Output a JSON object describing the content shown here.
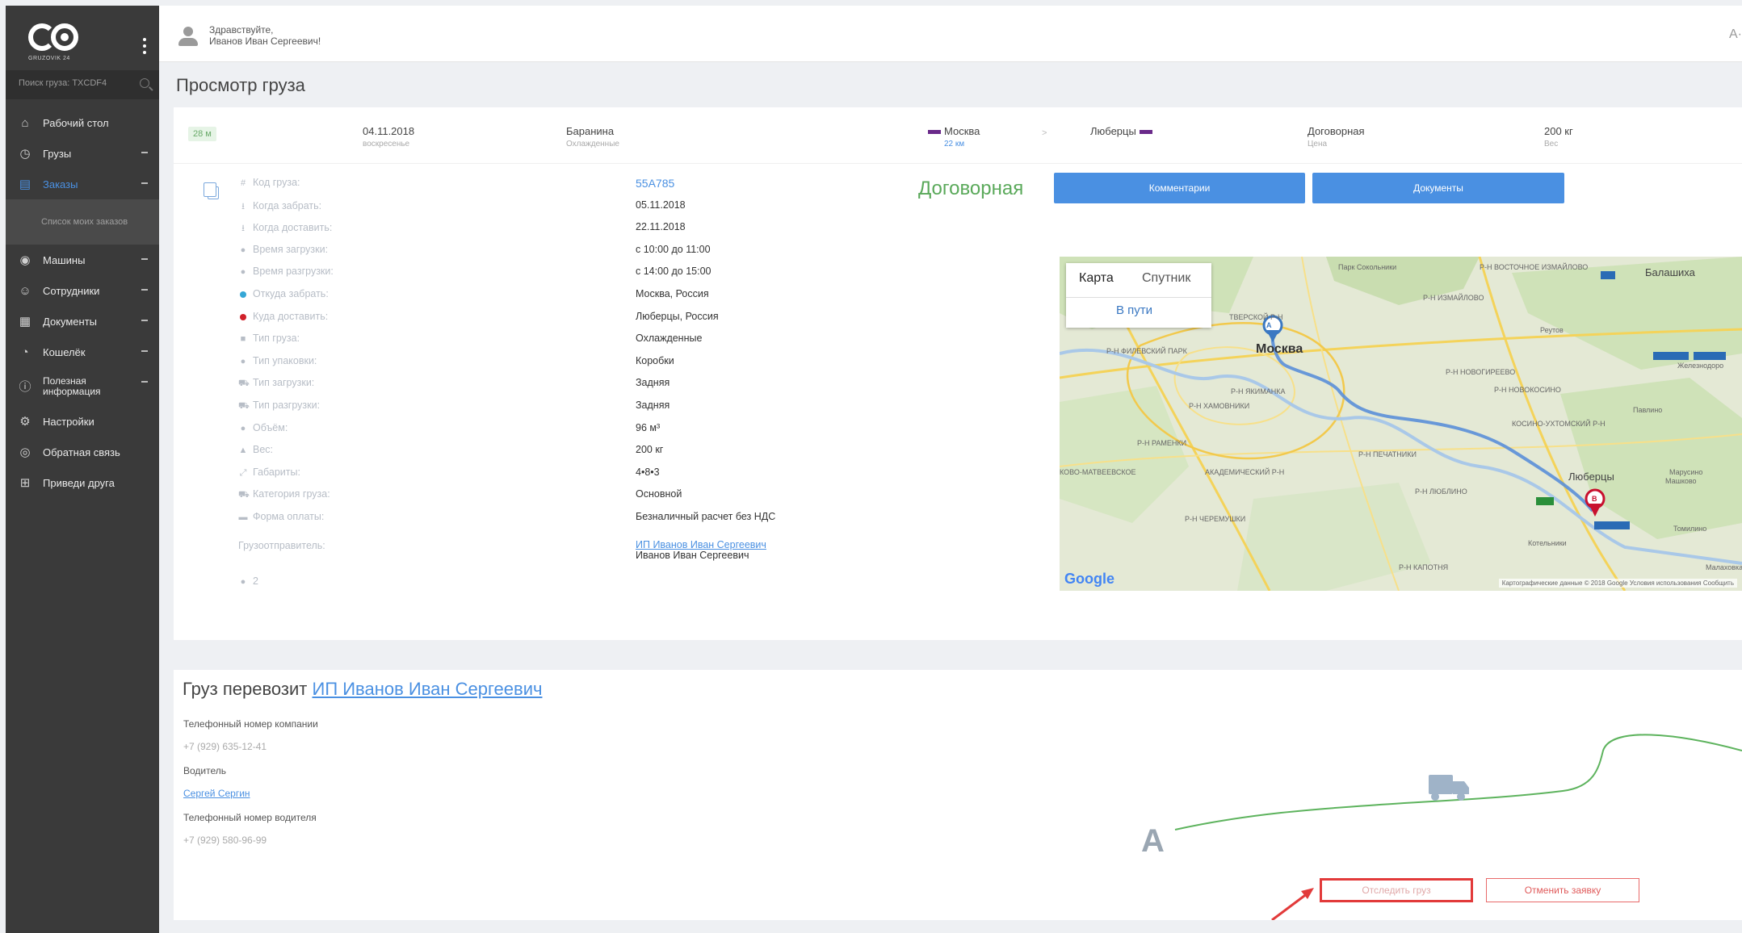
{
  "sidebar": {
    "logo_sub": "GRUZOVIK 24",
    "search_placeholder": "Поиск груза: TXCDF4",
    "items": [
      {
        "label": "Рабочий стол",
        "icon": "desktop-icon"
      },
      {
        "label": "Грузы",
        "icon": "cargo-icon"
      },
      {
        "label": "Заказы",
        "icon": "orders-icon"
      },
      {
        "label": "Список моих заказов",
        "icon": ""
      },
      {
        "label": "Машины",
        "icon": "truck-icon"
      },
      {
        "label": "Сотрудники",
        "icon": "staff-icon"
      },
      {
        "label": "Документы",
        "icon": "documents-icon"
      },
      {
        "label": "Кошелёк",
        "icon": "wallet-icon"
      },
      {
        "label": "Полезная информация",
        "icon": "info-icon"
      },
      {
        "label": "Настройки",
        "icon": "gear-icon"
      },
      {
        "label": "Обратная связь",
        "icon": "feedback-icon"
      },
      {
        "label": "Приведи друга",
        "icon": "gift-icon"
      }
    ]
  },
  "topbar": {
    "greet_line1": "Здравствуйте,",
    "greet_line2": "Иванов Иван Сергеевич!",
    "right_text": "А·"
  },
  "page": {
    "title": "Просмотр груза"
  },
  "summary": {
    "badge": "28 м",
    "date": "04.11.2018",
    "weekday": "воскресенье",
    "cargo": "Баранина",
    "cargo_type": "Охлажденные",
    "from": "Москва",
    "distance": "22 км",
    "chevron": ">",
    "to": "Люберцы",
    "price": "Договорная",
    "price_label": "Цена",
    "weight": "200 кг",
    "weight_label": "Вес"
  },
  "details": [
    {
      "label": "Код груза:",
      "value": "55A785",
      "icon": "#",
      "value_style": "blue"
    },
    {
      "label": "Когда забрать:",
      "value": "05.11.2018",
      "icon": "⭳"
    },
    {
      "label": "Когда доставить:",
      "value": "22.11.2018",
      "icon": "⭳"
    },
    {
      "label": "Время загрузки:",
      "value": "с 10:00 до 11:00",
      "icon": "●"
    },
    {
      "label": "Время разгрузки:",
      "value": "с 14:00 до 15:00",
      "icon": "●"
    },
    {
      "label": "Откуда забрать:",
      "value": "Москва, Россия",
      "icon": "dot-blue"
    },
    {
      "label": "Куда доставить:",
      "value": "Люберцы, Россия",
      "icon": "dot-red"
    },
    {
      "label": "Тип груза:",
      "value": "Охлажденные",
      "icon": "■"
    },
    {
      "label": "Тип упаковки:",
      "value": "Коробки",
      "icon": "●"
    },
    {
      "label": "Тип загрузки:",
      "value": "Задняя",
      "icon": "⛟"
    },
    {
      "label": "Тип разгрузки:",
      "value": "Задняя",
      "icon": "⛟"
    },
    {
      "label": "Объём:",
      "value": "96 м³",
      "icon": "●"
    },
    {
      "label": "Вес:",
      "value": "200 кг",
      "icon": "▲"
    },
    {
      "label": "Габариты:",
      "value": "4•8•3",
      "icon": "⤢"
    },
    {
      "label": "Категория груза:",
      "value": "Основной",
      "icon": "⛟"
    },
    {
      "label": "Форма оплаты:",
      "value": "Безналичный расчет без НДС",
      "icon": "▬"
    }
  ],
  "shipper": {
    "label": "Грузоотправитель:",
    "link": "ИП Иванов Иван Сергеевич",
    "name": "Иванов Иван Сергеевич",
    "count": "2"
  },
  "actions": {
    "price_big": "Договорная",
    "comments": "Комментарии",
    "documents": "Документы"
  },
  "map": {
    "tab_map": "Карта",
    "tab_satellite": "Спутник",
    "route_status": "В пути",
    "google": "Google",
    "footer": "Картографические данные © 2018 Google   Условия использования   Сообщить",
    "labels": [
      {
        "text": "Москва",
        "cls": "big"
      },
      {
        "text": "Люберцы",
        "cls": "med"
      },
      {
        "text": "Балашиха",
        "cls": "med"
      },
      {
        "text": "Реутов",
        "cls": ""
      },
      {
        "text": "Железнодоро",
        "cls": ""
      },
      {
        "text": "ТВЕРСКОЙ Р-Н",
        "cls": ""
      },
      {
        "text": "Р-Н ХАМОВНИКИ",
        "cls": ""
      },
      {
        "text": "Р-Н ЯКИМАНКА",
        "cls": ""
      },
      {
        "text": "Р-Н ФИЛЕВСКИЙ ПАРК",
        "cls": ""
      },
      {
        "text": "Р-Н РАМЕНКИ",
        "cls": ""
      },
      {
        "text": "АКАДЕМИЧЕСКИЙ Р-Н",
        "cls": ""
      },
      {
        "text": "Р-Н ПЕЧАТНИКИ",
        "cls": ""
      },
      {
        "text": "Р-Н ЛЮБЛИНО",
        "cls": ""
      },
      {
        "text": "Р-Н ЧЕРЕМУШКИ",
        "cls": ""
      },
      {
        "text": "Котельники",
        "cls": ""
      },
      {
        "text": "Р-Н КАПОТНЯ",
        "cls": ""
      },
      {
        "text": "КОСИНО-УХТОМСКИЙ Р-Н",
        "cls": ""
      },
      {
        "text": "Р-Н НОВОКОСИНО",
        "cls": ""
      },
      {
        "text": "Р-Н НОВОГИРЕЕВО",
        "cls": ""
      },
      {
        "text": "Р-Н ИЗМАЙЛОВО",
        "cls": ""
      },
      {
        "text": "Парк Сокольники",
        "cls": ""
      },
      {
        "text": "Р-Н ВОСТОЧНОЕ ИЗМАЙЛОВО",
        "cls": ""
      },
      {
        "text": "Павлино",
        "cls": ""
      },
      {
        "text": "Марусино",
        "cls": ""
      },
      {
        "text": "Машково",
        "cls": ""
      },
      {
        "text": "Томилино",
        "cls": ""
      },
      {
        "text": "Малаховка",
        "cls": ""
      },
      {
        "text": "КОВО-МАТВЕЕВСКОЕ",
        "cls": ""
      }
    ],
    "marker_a": "A",
    "marker_b": "B"
  },
  "carrier": {
    "title_prefix": "Груз перевозит",
    "title_link": "ИП Иванов Иван Сергеевич",
    "phone_label": "Телефонный номер компании",
    "phone": "+7 (929) 635-12-41",
    "driver_label": "Водитель",
    "driver": "Сергей Сергин",
    "driver_phone_label": "Телефонный номер водителя",
    "driver_phone": "+7 (929) 580-96-99",
    "track_point": "A",
    "track_button": "Отследить груз",
    "cancel_button": "Отменить заявку"
  },
  "colors": {
    "accent": "#4a90e2",
    "sidebar_bg": "#3a3a3a",
    "price_green": "#5aa95a",
    "route_line": "#5a8fd8",
    "track_line": "#5db35d",
    "highlight_red": "#e23a3a"
  }
}
